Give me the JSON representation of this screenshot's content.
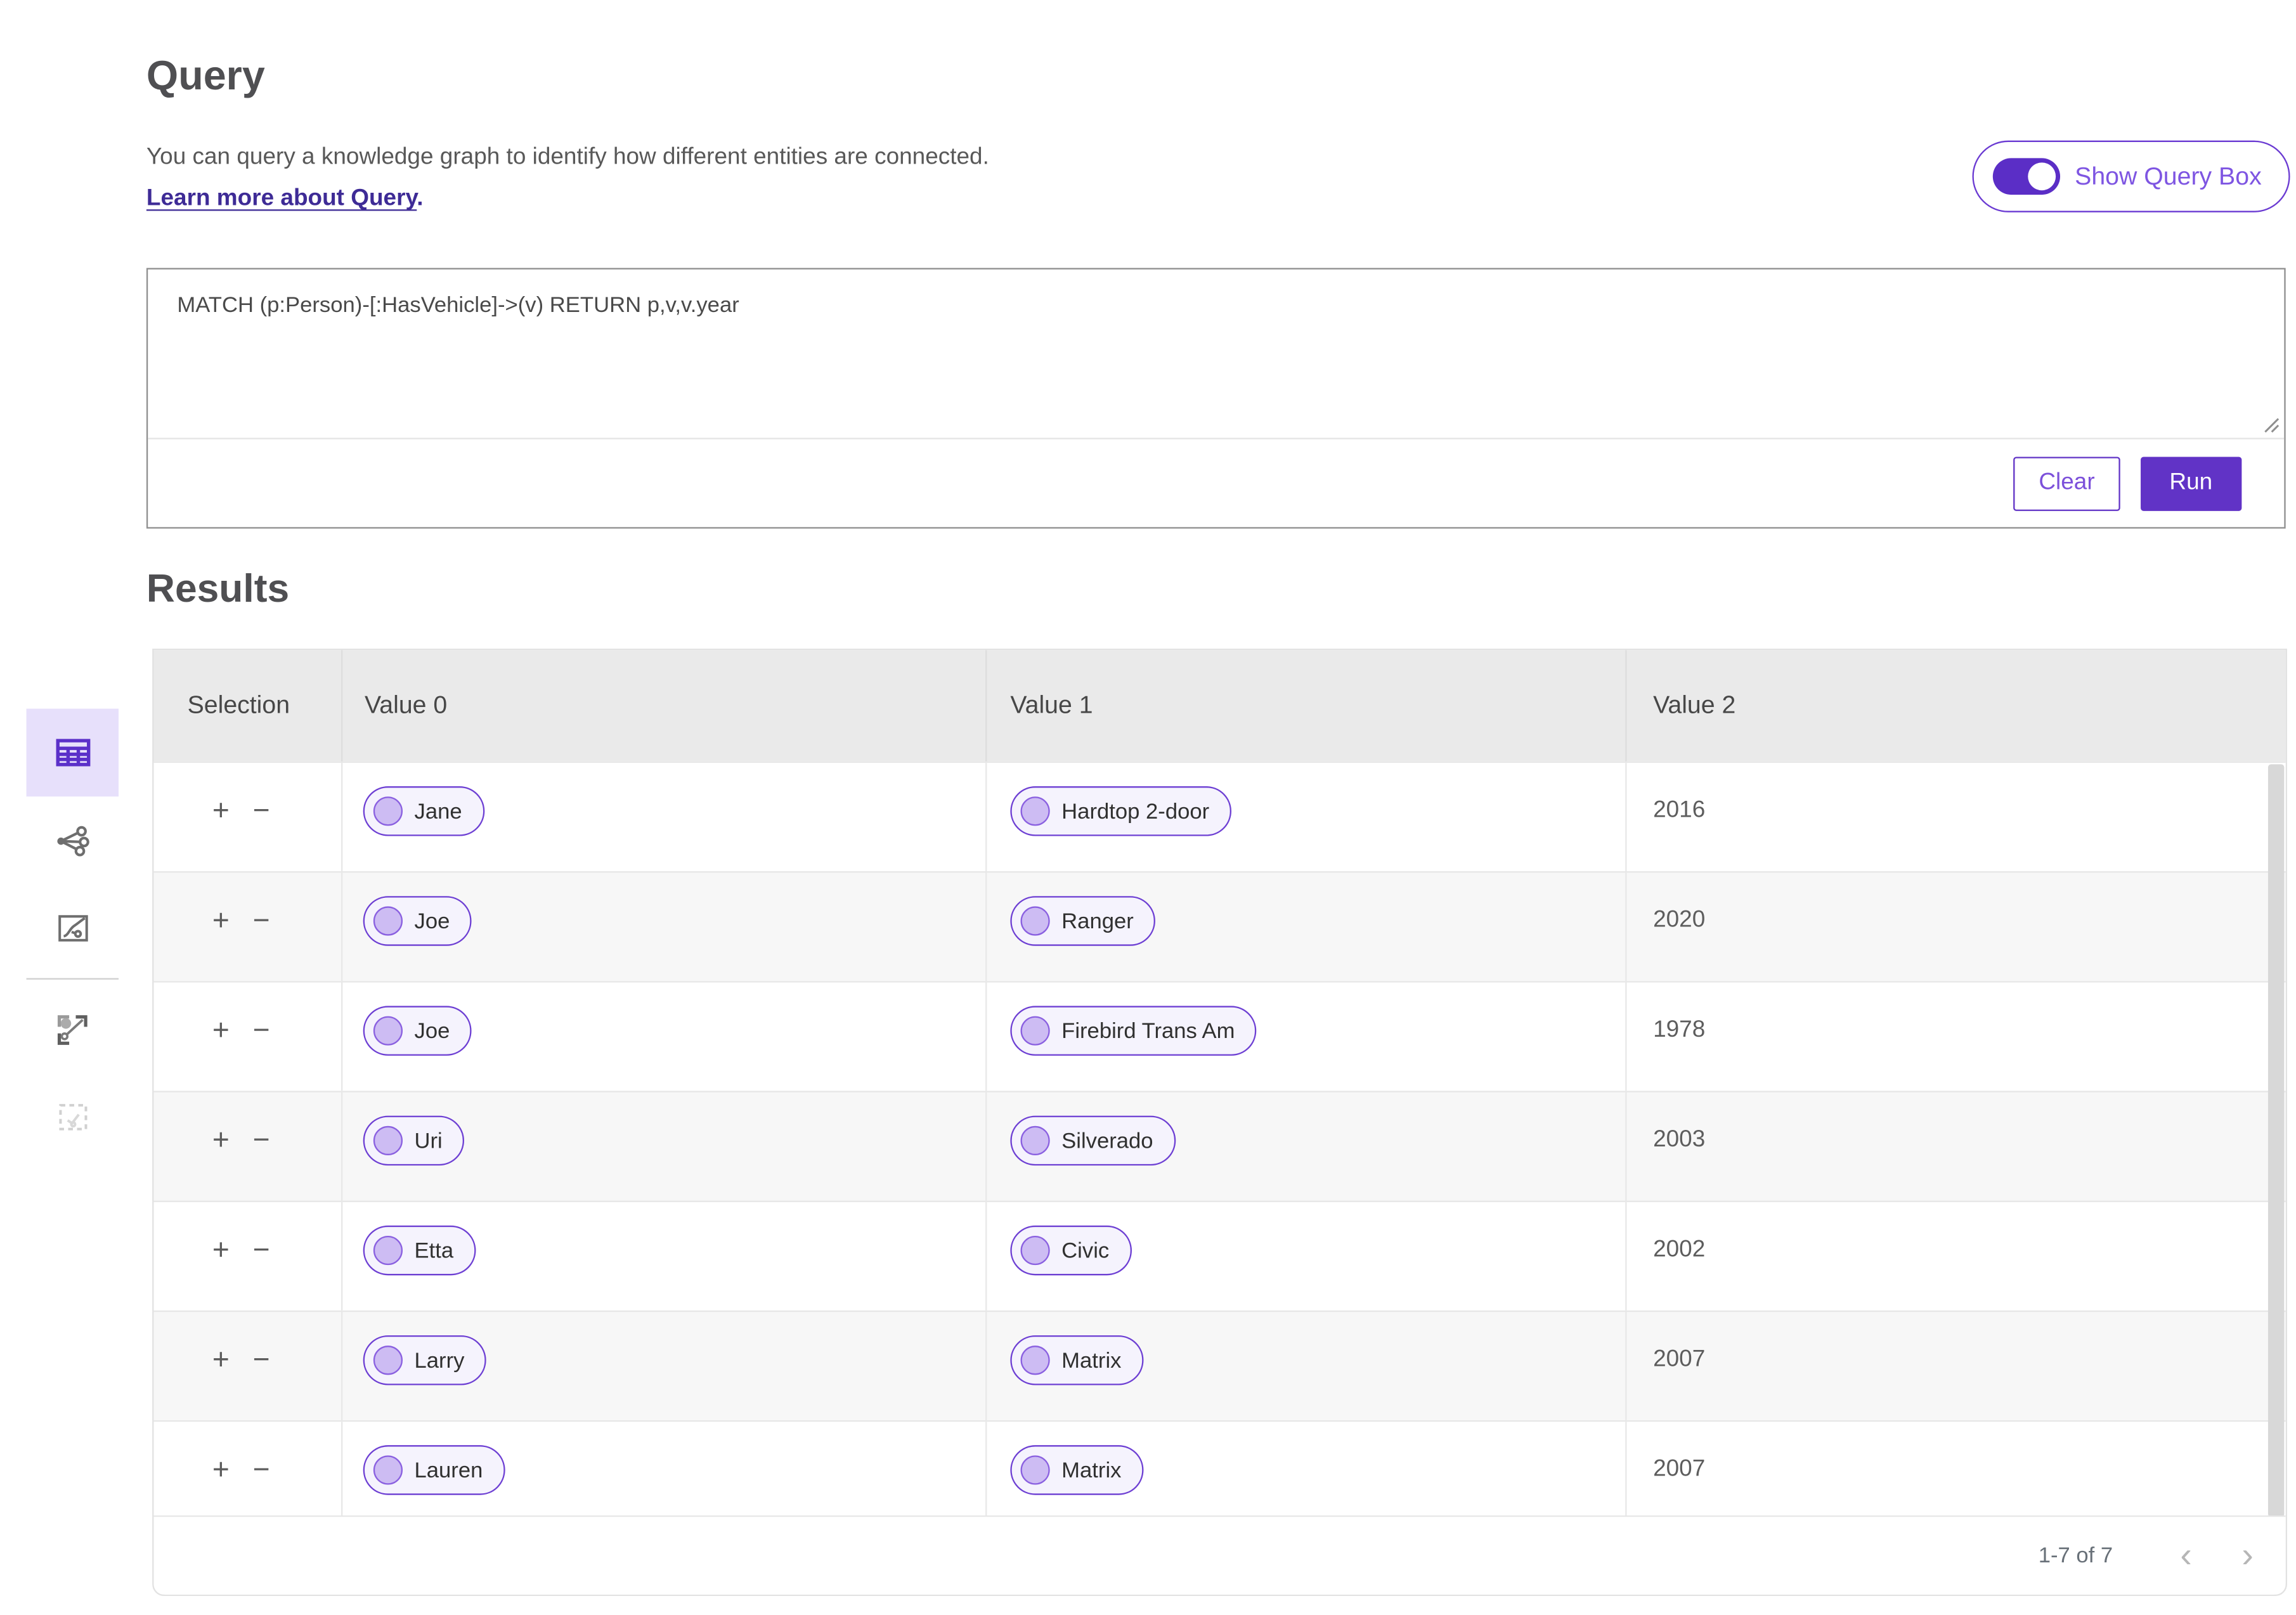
{
  "colors": {
    "accent_purple": "#6133c6",
    "pill_border": "#6d3fd3",
    "pill_background": "#f5f3fd",
    "pill_dot_fill": "#cdbcf3",
    "link_purple": "#3e2b96",
    "toggle_label_purple": "#7e55e2",
    "selected_sidebar_background": "#e7e0fb",
    "table_header_background": "#eaeaea",
    "alt_row_background": "#f7f7f7"
  },
  "header": {
    "title": "Query",
    "description": "You can query a knowledge graph to identify how different entities are connected.",
    "learn_more_label": "Learn more about Query",
    "learn_more_suffix": ".",
    "toggle_label": "Show Query Box",
    "toggle_state": "on"
  },
  "query_box": {
    "query_text": "MATCH (p:Person)-[:HasVehicle]->(v) RETURN p,v,v.year",
    "clear_label": "Clear",
    "run_label": "Run"
  },
  "sidebar": {
    "items": [
      {
        "name": "table-view",
        "icon": "table-icon",
        "selected": true,
        "disabled": false
      },
      {
        "name": "graph-view",
        "icon": "graph-nodes-icon",
        "selected": false,
        "disabled": false
      },
      {
        "name": "chart-view",
        "icon": "chart-icon",
        "selected": false,
        "disabled": false
      },
      {
        "name": "send-to-graph",
        "icon": "send-to-graph-icon",
        "selected": false,
        "disabled": false
      },
      {
        "name": "selection-view",
        "icon": "dashed-box-icon",
        "selected": false,
        "disabled": true
      }
    ]
  },
  "results": {
    "title": "Results",
    "columns": [
      "Selection",
      "Value 0",
      "Value 1",
      "Value 2"
    ],
    "rows": [
      {
        "value0": "Jane",
        "value1": "Hardtop 2-door",
        "value2": "2016"
      },
      {
        "value0": "Joe",
        "value1": "Ranger",
        "value2": "2020"
      },
      {
        "value0": "Joe",
        "value1": "Firebird Trans Am",
        "value2": "1978"
      },
      {
        "value0": "Uri",
        "value1": "Silverado",
        "value2": "2003"
      },
      {
        "value0": "Etta",
        "value1": "Civic",
        "value2": "2002"
      },
      {
        "value0": "Larry",
        "value1": "Matrix",
        "value2": "2007"
      },
      {
        "value0": "Lauren",
        "value1": "Matrix",
        "value2": "2007"
      }
    ],
    "pagination": {
      "label": "1-7 of 7"
    }
  },
  "row_controls": {
    "add_label": "+",
    "remove_label": "−"
  },
  "icons": {
    "chevron_left": "‹",
    "chevron_right": "›"
  }
}
